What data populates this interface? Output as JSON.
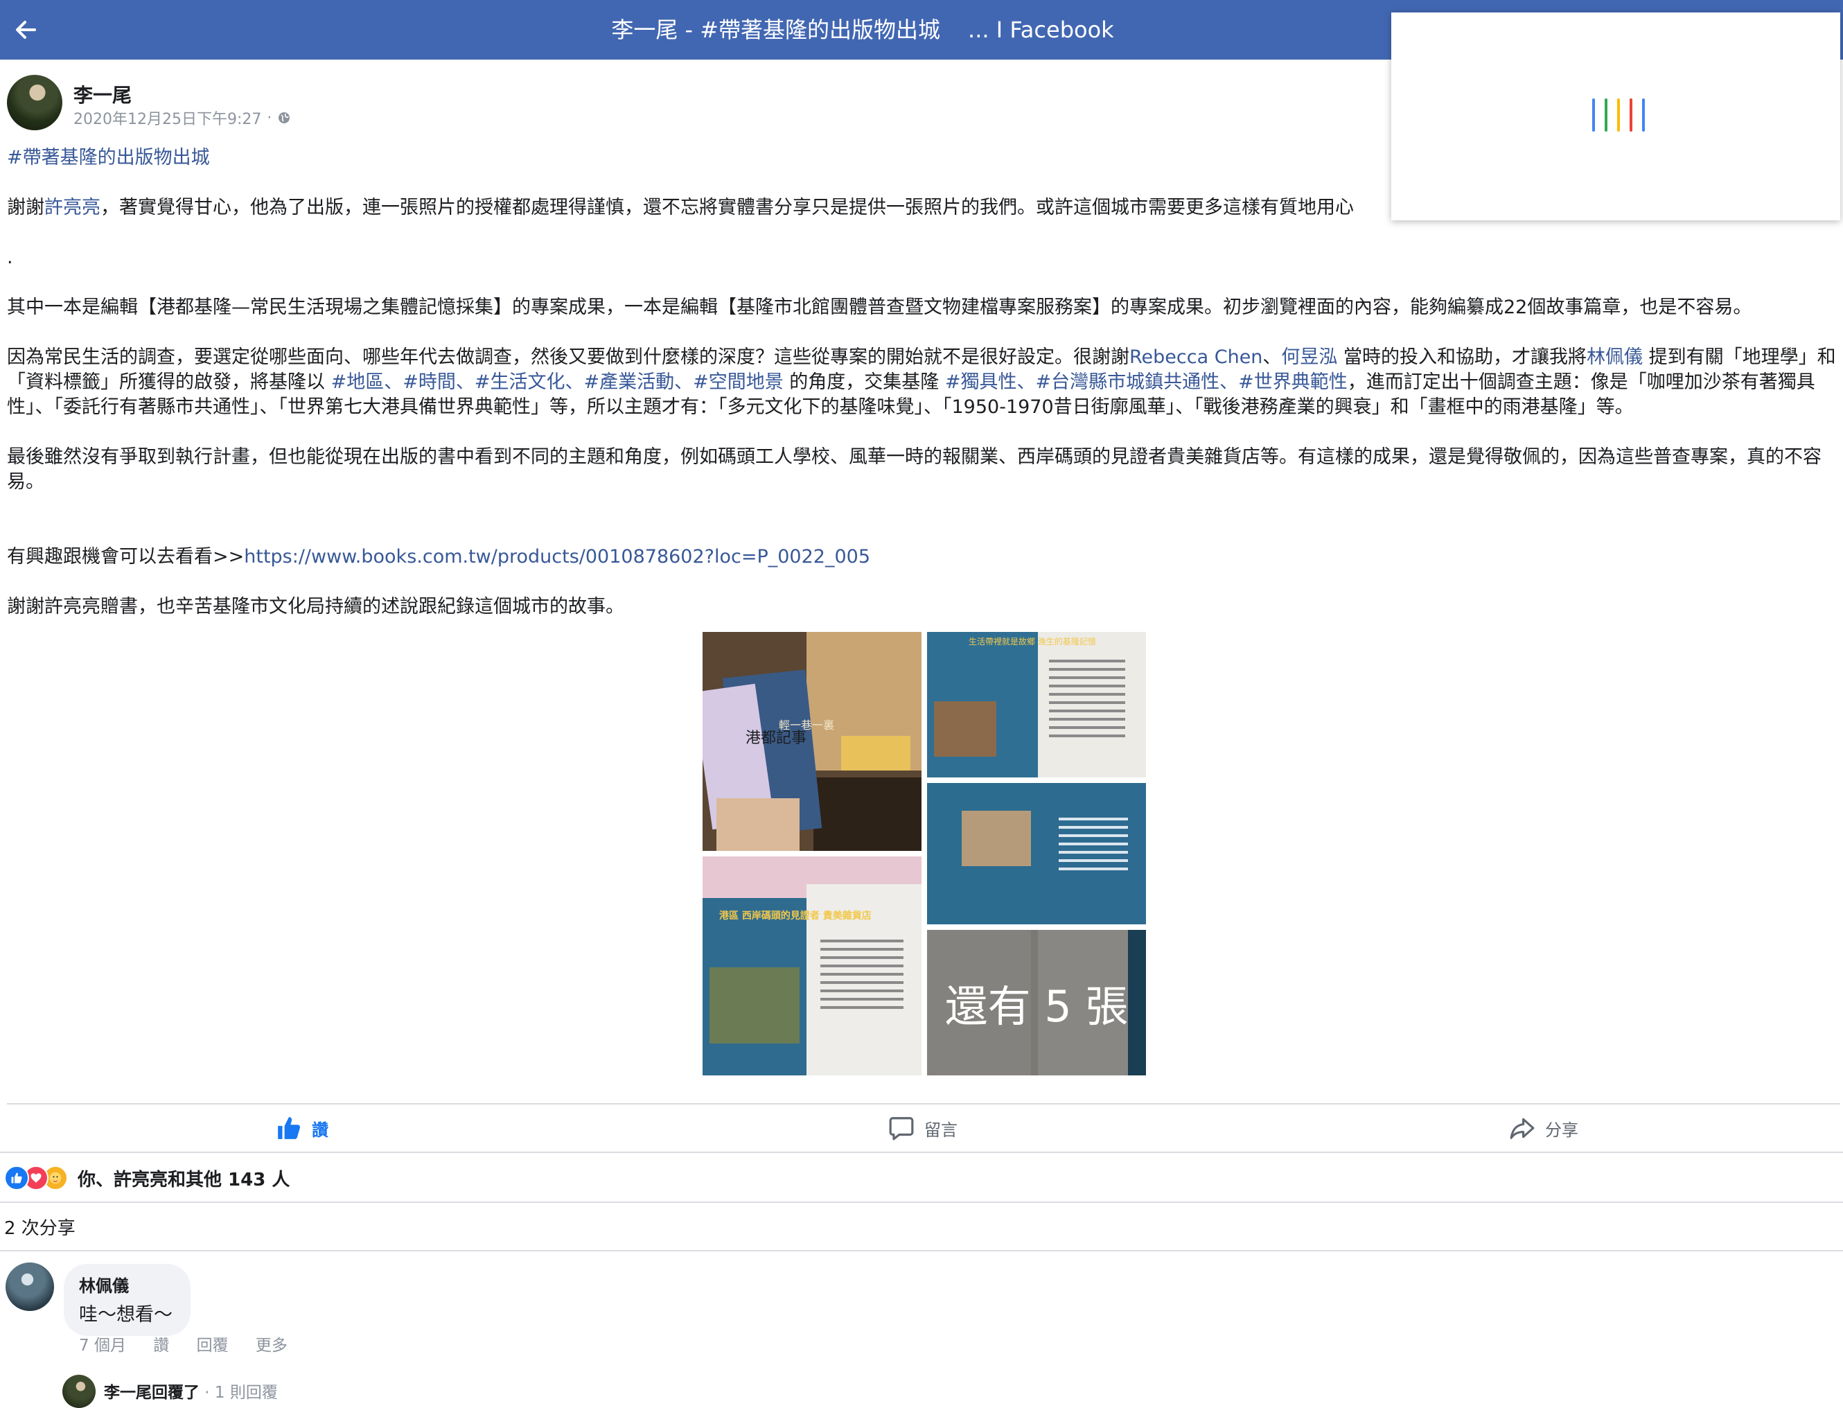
{
  "header": {
    "title_left": "李一尾 - #帶著基隆的出版物出城",
    "title_right": "... I Facebook",
    "bg_color": "#4267b2"
  },
  "popup": {
    "loader_colors": [
      "#4285f4",
      "#34a853",
      "#fbbc05",
      "#ea4335",
      "#4285f4"
    ]
  },
  "post": {
    "author": "李一尾",
    "timestamp": "2020年12月25日下午9:27",
    "meta_sep": " · ",
    "hashtag_heading": "#帶著基隆的出版物出城",
    "p1": {
      "pre": "謝謝",
      "mention": "許亮亮",
      "post": "，著實覺得甘心，他為了出版，連一張照片的授權都處理得謹慎，還不忘將實體書分享只是提供一張照片的我們。或許這個城市需要更多這樣有質地用心"
    },
    "dot": ".",
    "p2": "其中一本是編輯【港都基隆—常民生活現場之集體記憶採集】的專案成果，一本是編輯【基隆市北館團體普查暨文物建檔專案服務案】的專案成果。初步瀏覽裡面的內容，能夠編纂成22個故事篇章，也是不容易。",
    "p3": {
      "t1": "因為常民生活的調查，要選定從哪些面向、哪些年代去做調查，然後又要做到什麼樣的深度？這些從專案的開始就不是很好設定。很謝謝",
      "l1": "Rebecca Chen",
      "t2": "、",
      "l2": "何昱泓",
      "t3": " 當時的投入和協助，才讓我將",
      "l3": "林佩儀",
      "t4": " 提到有關「地理學」和「資料標籤」所獲得的啟發，將基隆以 ",
      "h1": "#地區",
      "s1": "、",
      "h2": "#時間",
      "s2": "、",
      "h3": "#生活文化",
      "s3": "、",
      "h4": "#產業活動",
      "s4": "、",
      "h5": "#空間地景",
      "t5": " 的角度，交集基隆 ",
      "h6": "#獨具性",
      "s5": "、",
      "h7": "#台灣縣市城鎮共通性",
      "s6": "、",
      "h8": "#世界典範性",
      "t6": "，進而訂定出十個調查主題：像是「咖哩加沙茶有著獨具性」、「委託行有著縣市共通性」、「世界第七大港具備世界典範性」等，所以主題才有：「多元文化下的基隆味覺」、「1950-1970昔日街廓風華」、「戰後港務產業的興衰」和「畫框中的雨港基隆」等。"
    },
    "p4": "最後雖然沒有爭取到執行計畫，但也能從現在出版的書中看到不同的主題和角度，例如碼頭工人學校、風華一時的報關業、西岸碼頭的見證者貴美雜貨店等。有這樣的成果，還是覺得敬佩的，因為這些普查專案，真的不容易。",
    "p5": {
      "pre": "有興趣跟機會可以去看看>>",
      "url": "https://www.books.com.tw/products/0010878602?loc=P_0022_005"
    },
    "p6": "謝謝許亮亮贈書，也辛苦基隆市文化局持續的述說跟紀錄這個城市的故事。",
    "gallery": {
      "more_label": "還有 5 張",
      "book_cover_text": "港都記事",
      "book_cover_text2": "輕一巷一裏",
      "page_title": "生活帶裡就是故鄉 漁生的基隆記憶",
      "page2_title": "港區 西岸碼頭的見證者 貴美雜貨店"
    }
  },
  "actions": {
    "like": "讚",
    "comment": "留言",
    "share": "分享"
  },
  "reactions": {
    "summary": "你、許亮亮和其他 143 人"
  },
  "shares": "2 次分享",
  "comment": {
    "author": "林佩儀",
    "text": "哇～想看～",
    "time": "7 個月",
    "like": "讚",
    "reply": "回覆",
    "more": "更多"
  },
  "reply": {
    "author": "李一尾回覆了",
    "count": " · 1 則回覆"
  }
}
